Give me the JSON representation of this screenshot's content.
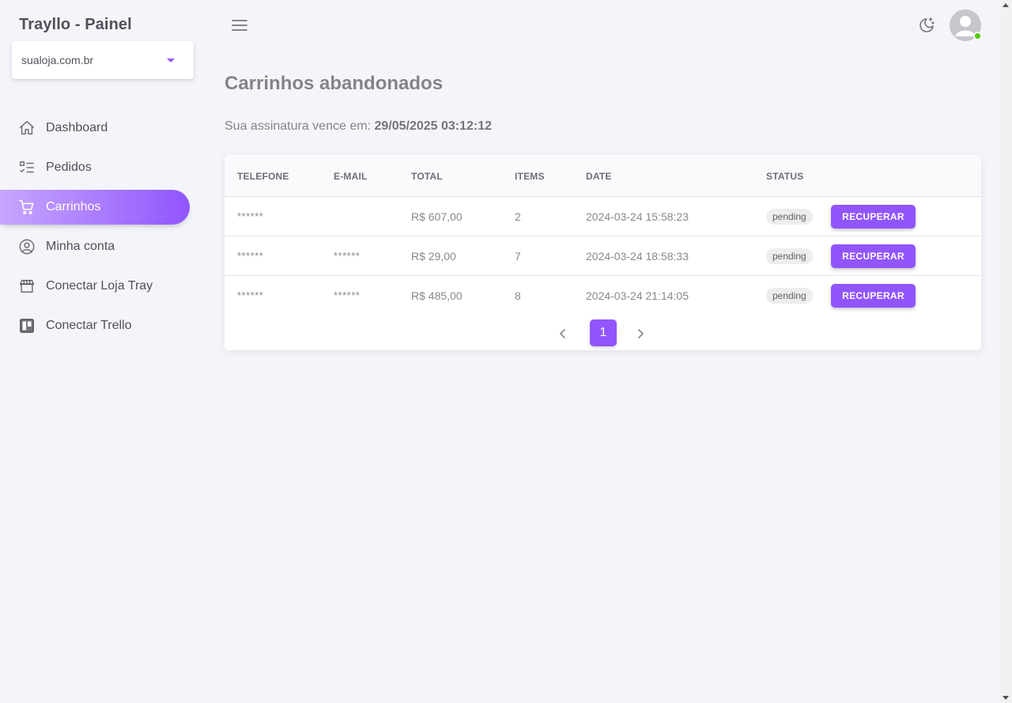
{
  "app": {
    "title": "Trayllo - Painel"
  },
  "store_select": {
    "value": "sualoja.com.br"
  },
  "sidebar": {
    "items": [
      {
        "label": "Dashboard",
        "icon": "home-icon",
        "active": false
      },
      {
        "label": "Pedidos",
        "icon": "checklist-icon",
        "active": false
      },
      {
        "label": "Carrinhos",
        "icon": "cart-icon",
        "active": true
      },
      {
        "label": "Minha conta",
        "icon": "user-circle-icon",
        "active": false
      },
      {
        "label": "Conectar Loja Tray",
        "icon": "storefront-icon",
        "active": false
      },
      {
        "label": "Conectar Trello",
        "icon": "trello-icon",
        "active": false
      }
    ]
  },
  "page": {
    "title": "Carrinhos abandonados",
    "subscription_label": "Sua assinatura vence em:",
    "subscription_date": "29/05/2025 03:12:12"
  },
  "table": {
    "headers": [
      "TELEFONE",
      "E-MAIL",
      "TOTAL",
      "ITEMS",
      "DATE",
      "STATUS"
    ],
    "rows": [
      {
        "phone": "******",
        "email": "",
        "total": "R$ 607,00",
        "items": "2",
        "date": "2024-03-24 15:58:23",
        "status": "pending",
        "action": "RECUPERAR"
      },
      {
        "phone": "******",
        "email": "******",
        "total": "R$ 29,00",
        "items": "7",
        "date": "2024-03-24 18:58:33",
        "status": "pending",
        "action": "RECUPERAR"
      },
      {
        "phone": "******",
        "email": "******",
        "total": "R$ 485,00",
        "items": "8",
        "date": "2024-03-24 21:14:05",
        "status": "pending",
        "action": "RECUPERAR"
      }
    ]
  },
  "pagination": {
    "current": "1"
  },
  "colors": {
    "primary": "#9155fd",
    "online": "#56ca00",
    "background": "#f4f5fa"
  }
}
